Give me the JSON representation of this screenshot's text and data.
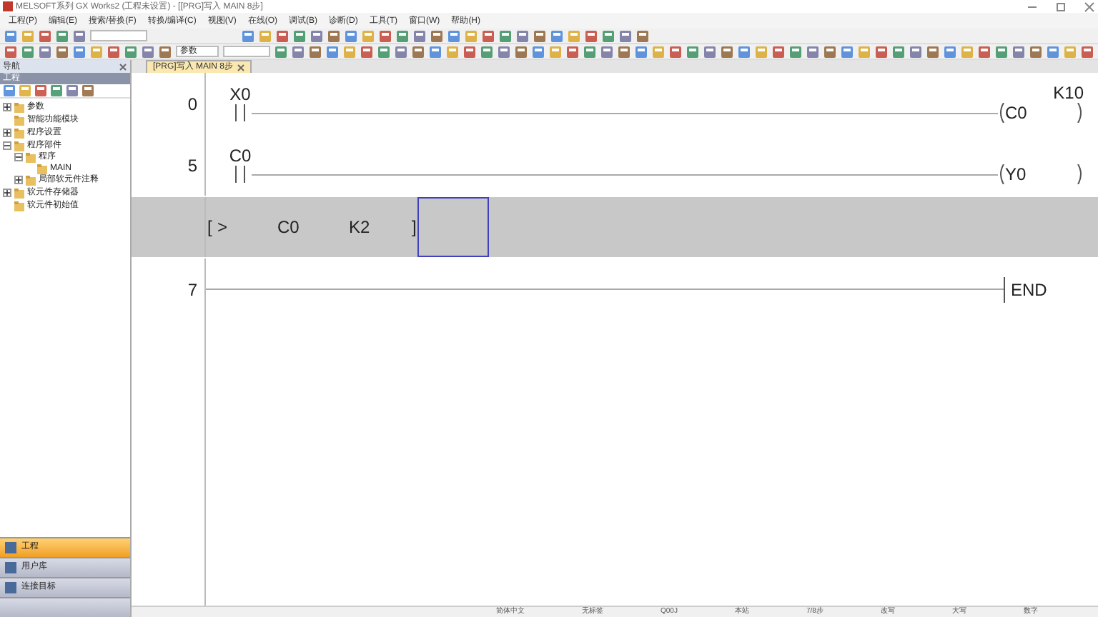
{
  "window": {
    "title": "MELSOFT系列 GX Works2 (工程未设置) - [[PRG]写入 MAIN 8步]"
  },
  "menu": [
    "工程(P)",
    "编辑(E)",
    "搜索/替换(F)",
    "转换/编译(C)",
    "视图(V)",
    "在线(O)",
    "调试(B)",
    "诊断(D)",
    "工具(T)",
    "窗口(W)",
    "帮助(H)"
  ],
  "toolbar": {
    "combo": "参数"
  },
  "navigation": {
    "title": "导航",
    "section": "工程",
    "tree": [
      {
        "label": "参数",
        "expanded": false
      },
      {
        "label": "智能功能模块"
      },
      {
        "label": "程序设置",
        "expanded": false
      },
      {
        "label": "程序部件",
        "expanded": true,
        "children": [
          {
            "label": "程序",
            "expanded": true,
            "children": [
              {
                "label": "MAIN"
              }
            ]
          },
          {
            "label": "局部软元件注释",
            "expanded": false
          }
        ]
      },
      {
        "label": "软元件存储器",
        "expanded": false
      },
      {
        "label": "软元件初始值"
      }
    ],
    "bottom_tabs": [
      {
        "label": "工程",
        "selected": true
      },
      {
        "label": "用户库",
        "selected": false
      },
      {
        "label": "连接目标",
        "selected": false
      }
    ]
  },
  "tab": {
    "label": "[PRG]写入 MAIN 8步",
    "selected": true
  },
  "ladder": [
    {
      "kind": "rung",
      "step": "0",
      "contact": "X0",
      "coil": "C0",
      "setting": "K10"
    },
    {
      "kind": "rung",
      "step": "5",
      "contact": "C0",
      "coil": "Y0"
    },
    {
      "kind": "edit",
      "parts": [
        "[",
        ">",
        "C0",
        "K2",
        "]"
      ]
    },
    {
      "kind": "end",
      "step": "7",
      "label": "END"
    }
  ],
  "status_bar": [
    "简体中文",
    "无标签",
    "Q00J",
    "本站",
    "7/8步",
    "改写",
    "大写",
    "数字"
  ]
}
